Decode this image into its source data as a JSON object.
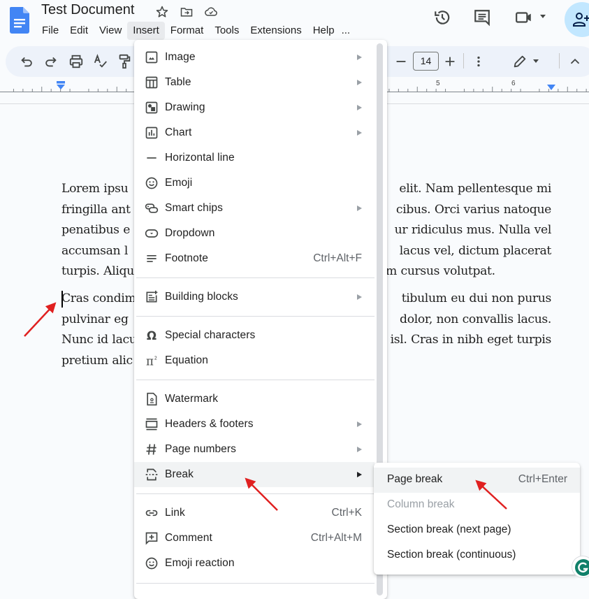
{
  "app": {
    "title": "Test Document",
    "menus": [
      "File",
      "Edit",
      "View",
      "Insert",
      "Format",
      "Tools",
      "Extensions",
      "Help",
      "..."
    ],
    "active_menu": "Insert",
    "accent": "#1a73e8"
  },
  "toolbar": {
    "font_size": "14"
  },
  "ruler": {
    "numbers": [
      "5",
      "6"
    ]
  },
  "document": {
    "paragraphs": [
      "Lorem ipsum dolor sit amet, consectetur adipiscing elit. Nam pellentesque mi fringilla ante ultricies, at faucibus. Orci varius natoque penatibus et magnis dis parturient montes, nascetur ridiculus mus. Nulla vel accumsan ligula. Pellentesque sed lacus vel, dictum placerat turpis. Aliquam sit amet diam cursus volutpat.",
      "Cras condimentum sem vitae sem vestibulum eu dui non purus pulvinar egestas. Sed vehicula dolor, non convallis lacus. Nunc id lacus vitae eros pulvinar nisl. Cras in nibh eget turpis pretium aliquam."
    ],
    "visible_fragments": {
      "p1": [
        {
          "left": "Lorem ipsu",
          "right": "elit. Nam pellentesque mi"
        },
        {
          "left": "fringilla ant",
          "right": "cibus. Orci varius natoque"
        },
        {
          "left": "penatibus e",
          "right": "ur ridiculus mus. Nulla vel"
        },
        {
          "left": "accumsan l",
          "right": "lacus vel, dictum placerat"
        },
        {
          "left": "turpis. Aliqu",
          "right": "m cursus volutpat."
        }
      ],
      "p2": [
        {
          "left": "Cras condim",
          "right": "tibulum eu dui non purus"
        },
        {
          "left": "pulvinar eg",
          "right": "dolor, non convallis lacus."
        },
        {
          "left": "Nunc id lacu",
          "right": "isl. Cras in nibh eget turpis"
        },
        {
          "left": "pretium alic",
          "right": ""
        }
      ]
    }
  },
  "insert_menu": {
    "items": [
      {
        "label": "Image",
        "icon": "image-icon",
        "submenu": true
      },
      {
        "label": "Table",
        "icon": "table-icon",
        "submenu": true
      },
      {
        "label": "Drawing",
        "icon": "drawing-icon",
        "submenu": true
      },
      {
        "label": "Chart",
        "icon": "chart-icon",
        "submenu": true
      },
      {
        "label": "Horizontal line",
        "icon": "horizontal-line-icon",
        "submenu": false
      },
      {
        "label": "Emoji",
        "icon": "emoji-icon",
        "submenu": false
      },
      {
        "label": "Smart chips",
        "icon": "smart-chips-icon",
        "submenu": true
      },
      {
        "label": "Dropdown",
        "icon": "dropdown-icon",
        "submenu": false
      },
      {
        "label": "Footnote",
        "icon": "footnote-icon",
        "shortcut": "Ctrl+Alt+F"
      },
      {
        "label": "Building blocks",
        "icon": "building-blocks-icon",
        "submenu": true
      },
      {
        "label": "Special characters",
        "icon": "omega-icon",
        "submenu": false
      },
      {
        "label": "Equation",
        "icon": "pi-icon",
        "submenu": false
      },
      {
        "label": "Watermark",
        "icon": "watermark-icon",
        "submenu": false
      },
      {
        "label": "Headers & footers",
        "icon": "headers-footers-icon",
        "submenu": true
      },
      {
        "label": "Page numbers",
        "icon": "hash-icon",
        "submenu": true
      },
      {
        "label": "Break",
        "icon": "break-icon",
        "submenu": true,
        "highlighted": true
      },
      {
        "label": "Link",
        "icon": "link-icon",
        "shortcut": "Ctrl+K"
      },
      {
        "label": "Comment",
        "icon": "comment-add-icon",
        "shortcut": "Ctrl+Alt+M"
      },
      {
        "label": "Emoji reaction",
        "icon": "emoji-reaction-icon",
        "submenu": false
      }
    ]
  },
  "break_submenu": {
    "items": [
      {
        "label": "Page break",
        "shortcut": "Ctrl+Enter",
        "highlighted": true
      },
      {
        "label": "Column break",
        "disabled": true
      },
      {
        "label": "Section break (next page)"
      },
      {
        "label": "Section break (continuous)"
      }
    ]
  }
}
